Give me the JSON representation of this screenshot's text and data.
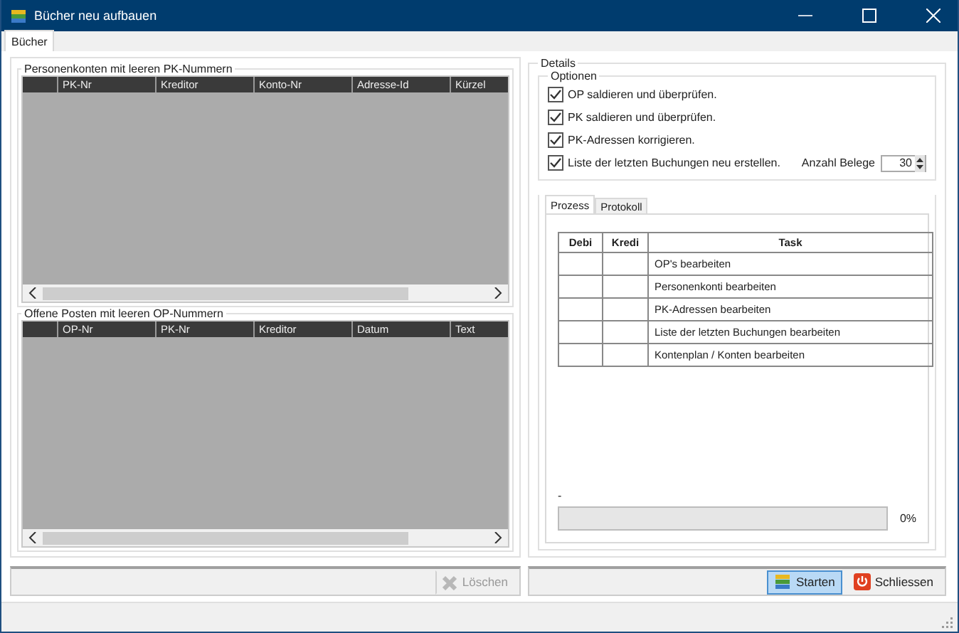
{
  "window": {
    "title": "Bücher neu aufbauen"
  },
  "tabs": [
    {
      "label": "Bücher",
      "selected": true
    }
  ],
  "left": {
    "groups": [
      {
        "title": "Personenkonten mit leeren PK-Nummern",
        "columns": [
          "PK-Nr",
          "Kreditor",
          "Konto-Nr",
          "Adresse-Id",
          "Kürzel"
        ]
      },
      {
        "title": "Offene Posten mit leeren OP-Nummern",
        "columns": [
          "OP-Nr",
          "PK-Nr",
          "Kreditor",
          "Datum",
          "Text"
        ]
      }
    ],
    "toolbar": {
      "buttons": [
        {
          "label": "Löschen",
          "disabled": true,
          "focused": false
        }
      ]
    }
  },
  "details": {
    "title": "Details",
    "options": {
      "title": "Optionen",
      "items": [
        {
          "label": "OP saldieren und überprüfen.",
          "checked": true
        },
        {
          "label": "PK saldieren und überprüfen.",
          "checked": true
        },
        {
          "label": "PK-Adressen korrigieren.",
          "checked": true
        },
        {
          "label": "Liste der letzten Buchungen neu erstellen.",
          "checked": true
        }
      ],
      "count": {
        "label": "Anzahl Belege",
        "value": "30"
      }
    },
    "tabs": [
      {
        "label": "Prozess",
        "selected": true
      },
      {
        "label": "Protokoll",
        "selected": false
      }
    ],
    "table": {
      "columns": [
        "Debi",
        "Kredi",
        "Task"
      ],
      "rows": [
        {
          "task": "OP's bearbeiten"
        },
        {
          "task": "Personenkonti bearbeiten"
        },
        {
          "task": "PK-Adressen bearbeiten"
        },
        {
          "task": "Liste der letzten Buchungen bearbeiten"
        },
        {
          "task": "Kontenplan / Konten bearbeiten"
        }
      ]
    },
    "status": "-",
    "progress": {
      "level": 0,
      "reading": "0%"
    }
  },
  "right_toolbar": {
    "buttons": [
      {
        "label": "Starten",
        "disabled": false,
        "focused": true
      },
      {
        "label": "Schliessen",
        "disabled": false,
        "focused": false
      }
    ]
  }
}
